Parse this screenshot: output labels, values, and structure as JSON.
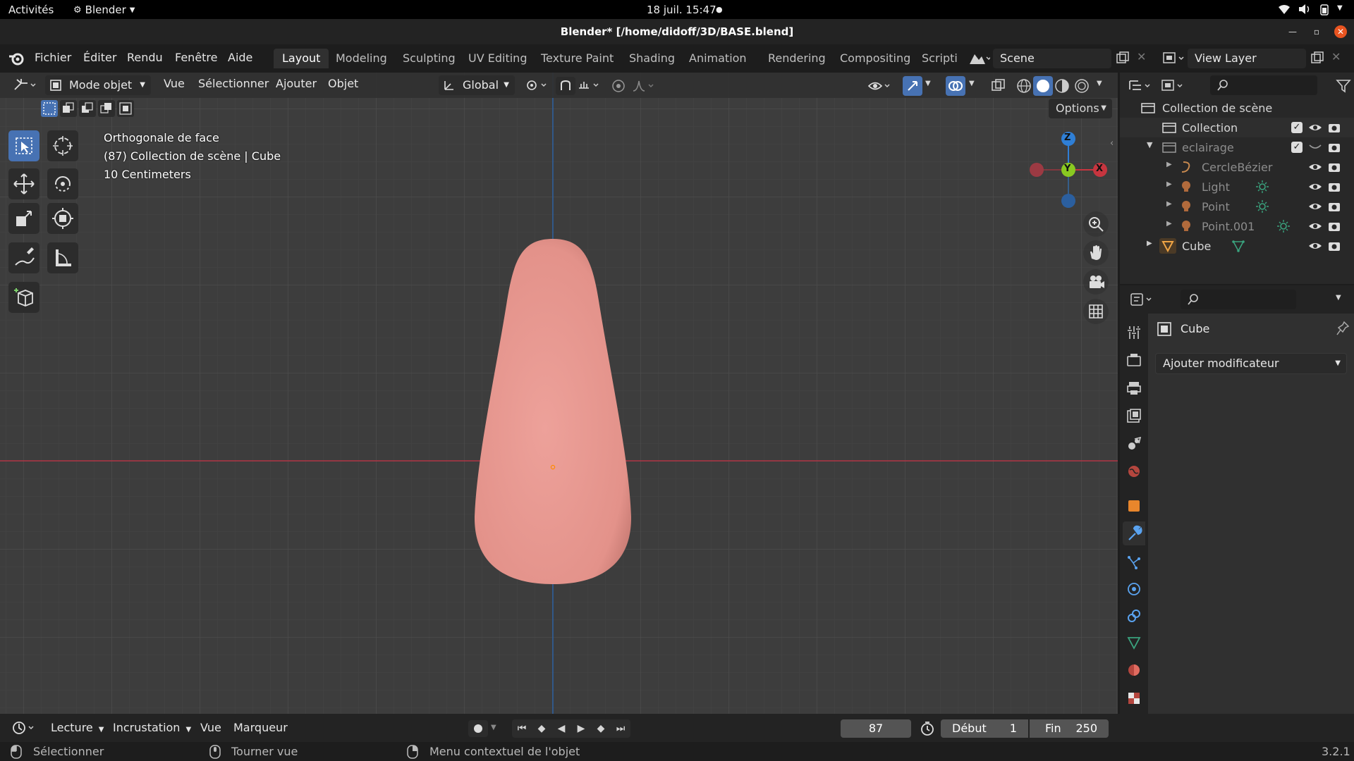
{
  "system_bar": {
    "activities": "Activités",
    "app": "Blender",
    "clock": "18 juil.  15:47"
  },
  "window": {
    "title": "Blender* [/home/didoff/3D/BASE.blend]"
  },
  "menus": [
    "Fichier",
    "Éditer",
    "Rendu",
    "Fenêtre",
    "Aide"
  ],
  "workspaces": [
    "Layout",
    "Modeling",
    "Sculpting",
    "UV Editing",
    "Texture Paint",
    "Shading",
    "Animation",
    "Rendering",
    "Compositing",
    "Scripting"
  ],
  "active_workspace": "Layout",
  "scene": {
    "name": "Scene",
    "view_layer": "View Layer"
  },
  "viewport_header": {
    "mode": "Mode objet",
    "view": "Vue",
    "select": "Sélectionner",
    "add": "Ajouter",
    "object": "Objet",
    "orientation": "Global",
    "options": "Options"
  },
  "viewport_overlay": {
    "view_name": "Orthogonale de face",
    "collection_info": "(87) Collection de scène | Cube",
    "scale": "10 Centimeters"
  },
  "gizmo": {
    "z": "Z",
    "y": "Y",
    "x": "X"
  },
  "outliner": {
    "root": "Collection de scène",
    "items": [
      {
        "name": "Collection"
      },
      {
        "name": "eclairage"
      },
      {
        "name": "CercleBézier"
      },
      {
        "name": "Light"
      },
      {
        "name": "Point"
      },
      {
        "name": "Point.001"
      },
      {
        "name": "Cube"
      }
    ]
  },
  "properties": {
    "object_name": "Cube",
    "add_modifier": "Ajouter modificateur"
  },
  "timeline": {
    "playback": "Lecture",
    "keying": "Incrustation",
    "view": "Vue",
    "marker": "Marqueur",
    "current_frame": "87",
    "start_label": "Début",
    "start": "1",
    "end_label": "Fin",
    "end": "250"
  },
  "status_bar": {
    "select": "Sélectionner",
    "rotate": "Tourner vue",
    "context": "Menu contextuel de l'objet",
    "version": "3.2.1"
  },
  "colors": {
    "accent": "#4772b3",
    "object": "#e99b93",
    "x_axis": "#c7353f",
    "y_axis": "#8ac921",
    "z_axis": "#2f7fd6"
  }
}
